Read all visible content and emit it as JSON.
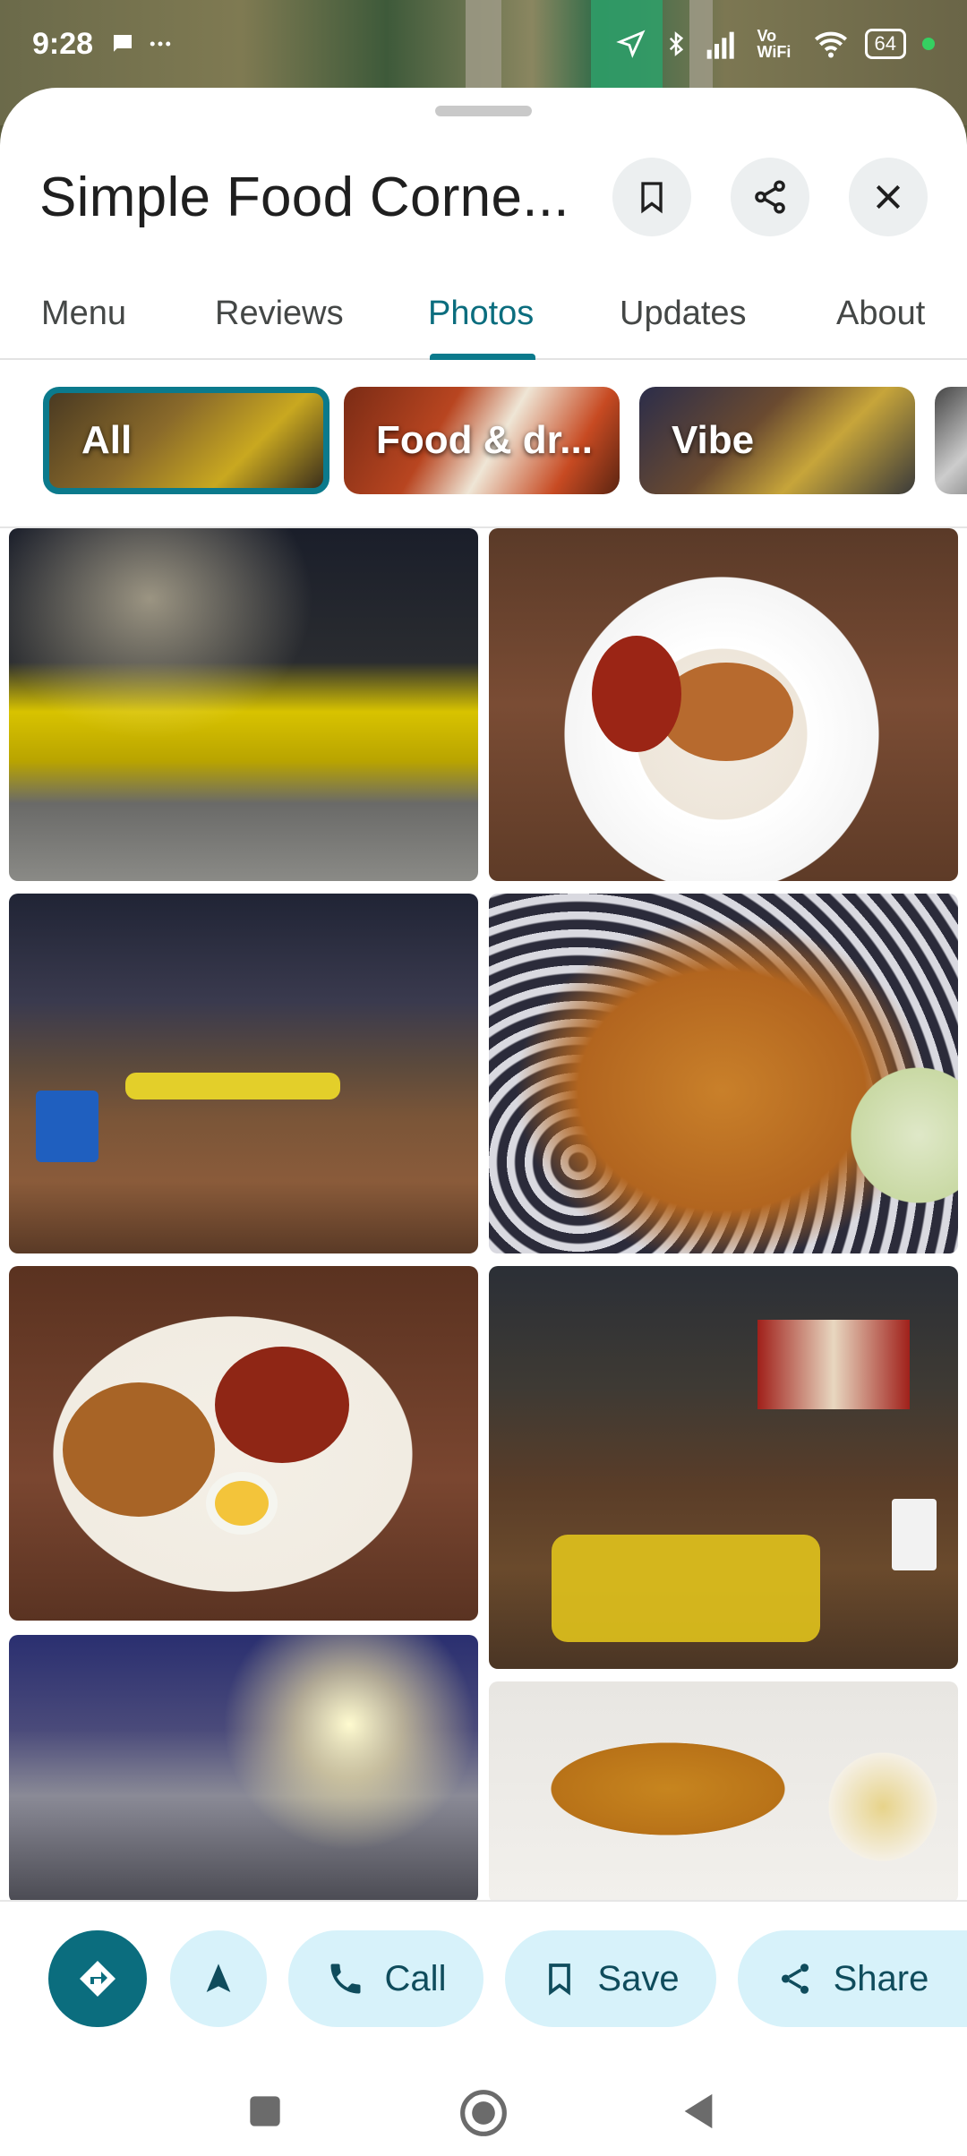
{
  "status_bar": {
    "time": "9:28",
    "network_label": "Vo WiFi",
    "battery": "64"
  },
  "place": {
    "title": "Simple Food Corne..."
  },
  "header_actions": {
    "save_icon": "bookmark-icon",
    "share_icon": "share-icon",
    "close_icon": "close-icon"
  },
  "tabs": [
    {
      "label": "Menu",
      "active": false
    },
    {
      "label": "Reviews",
      "active": false
    },
    {
      "label": "Photos",
      "active": true
    },
    {
      "label": "Updates",
      "active": false
    },
    {
      "label": "About",
      "active": false
    }
  ],
  "chips": [
    {
      "label": "All",
      "selected": true
    },
    {
      "label": "Food & dr...",
      "selected": false
    },
    {
      "label": "Vibe",
      "selected": false
    }
  ],
  "photos": [
    {
      "subject": "outdoor dining area with yellow chairs"
    },
    {
      "subject": "plate of rice with fried chicken and egg"
    },
    {
      "subject": "indoor dining hall with wooden table"
    },
    {
      "subject": "fried noodles with egg and cucumber"
    },
    {
      "subject": "plate of rice with fried chicken and boiled egg"
    },
    {
      "subject": "counter area with yellow chairs"
    },
    {
      "subject": "blurred night interior with lights"
    },
    {
      "subject": "fried chicken with egg close-up"
    }
  ],
  "bottom_actions": {
    "directions_icon": "directions-icon",
    "start_icon": "navigation-arrow-icon",
    "call_label": "Call",
    "save_label": "Save",
    "share_label": "Share"
  },
  "colors": {
    "accent": "#0b6d7e",
    "action_bg": "#d7f2fa",
    "action_text": "#0f4c5c"
  }
}
